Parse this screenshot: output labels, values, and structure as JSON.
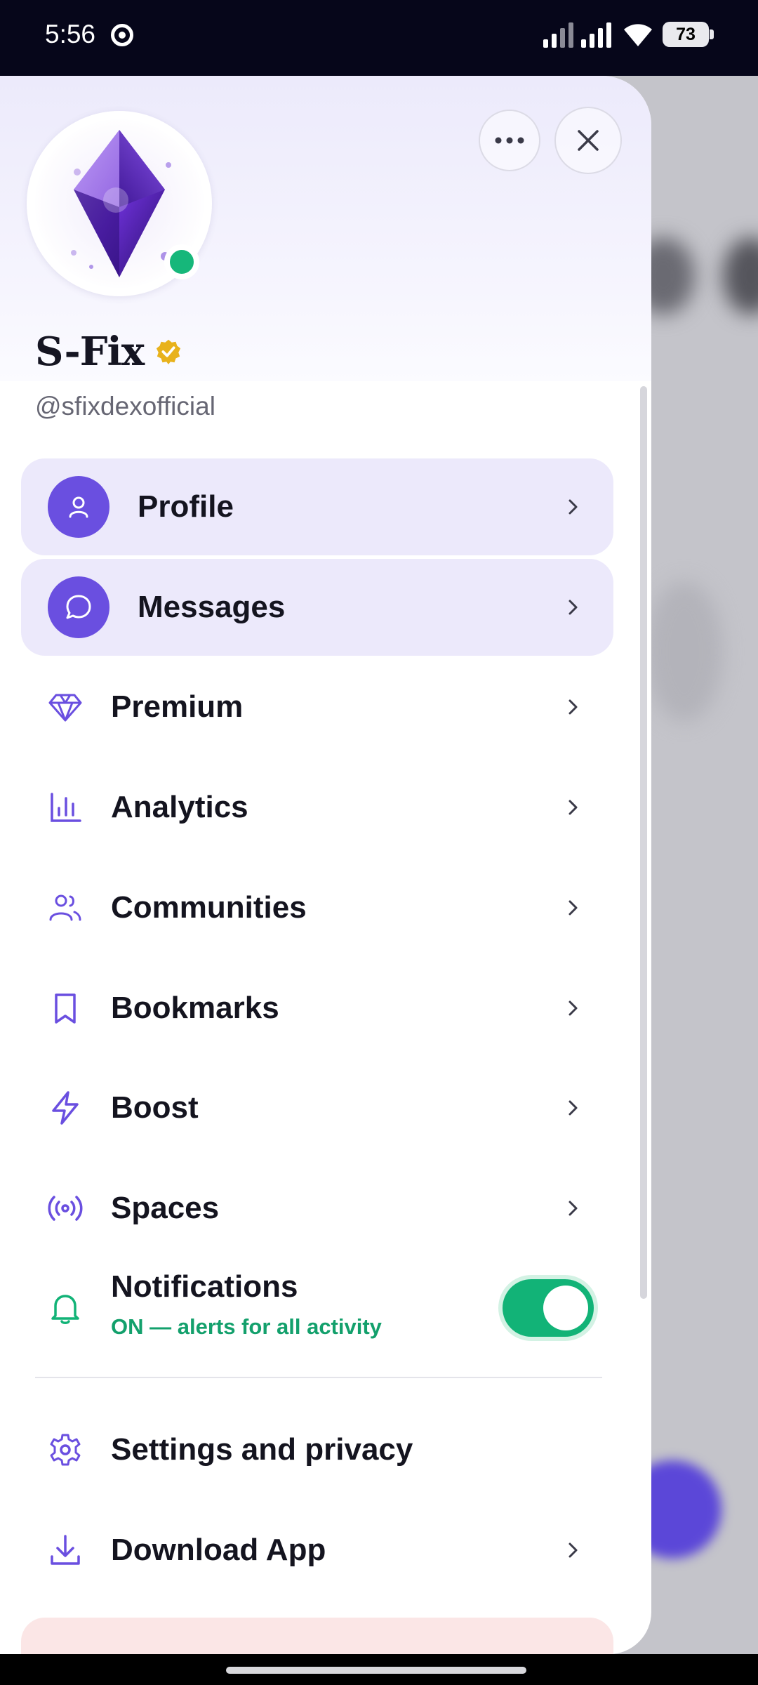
{
  "status_bar": {
    "time": "5:56",
    "battery": "73"
  },
  "profile": {
    "display_name": "S-Fix",
    "handle": "@sfixdexofficial",
    "verified": true,
    "online": true
  },
  "header_buttons": {
    "more_icon": "more-horizontal-icon",
    "close_icon": "close-icon"
  },
  "menu": {
    "profile": {
      "label": "Profile",
      "icon": "user-icon"
    },
    "messages": {
      "label": "Messages",
      "icon": "chat-bubble-icon"
    },
    "premium": {
      "label": "Premium",
      "icon": "diamond-icon"
    },
    "analytics": {
      "label": "Analytics",
      "icon": "bar-chart-icon"
    },
    "communities": {
      "label": "Communities",
      "icon": "users-icon"
    },
    "bookmarks": {
      "label": "Bookmarks",
      "icon": "bookmark-icon"
    },
    "boost": {
      "label": "Boost",
      "icon": "lightning-icon"
    },
    "spaces": {
      "label": "Spaces",
      "icon": "broadcast-icon"
    },
    "notifications": {
      "label": "Notifications",
      "subtitle": "ON — alerts for all activity",
      "enabled": true,
      "icon": "bell-icon"
    },
    "settings": {
      "label": "Settings and privacy",
      "icon": "gear-icon"
    },
    "download": {
      "label": "Download App",
      "icon": "download-icon"
    }
  },
  "colors": {
    "accent": "#6a4fe0",
    "highlight_bg": "#ece9fb",
    "success": "#12b377",
    "verified": "#e8b21c",
    "danger_bg": "#fbe6e6"
  }
}
